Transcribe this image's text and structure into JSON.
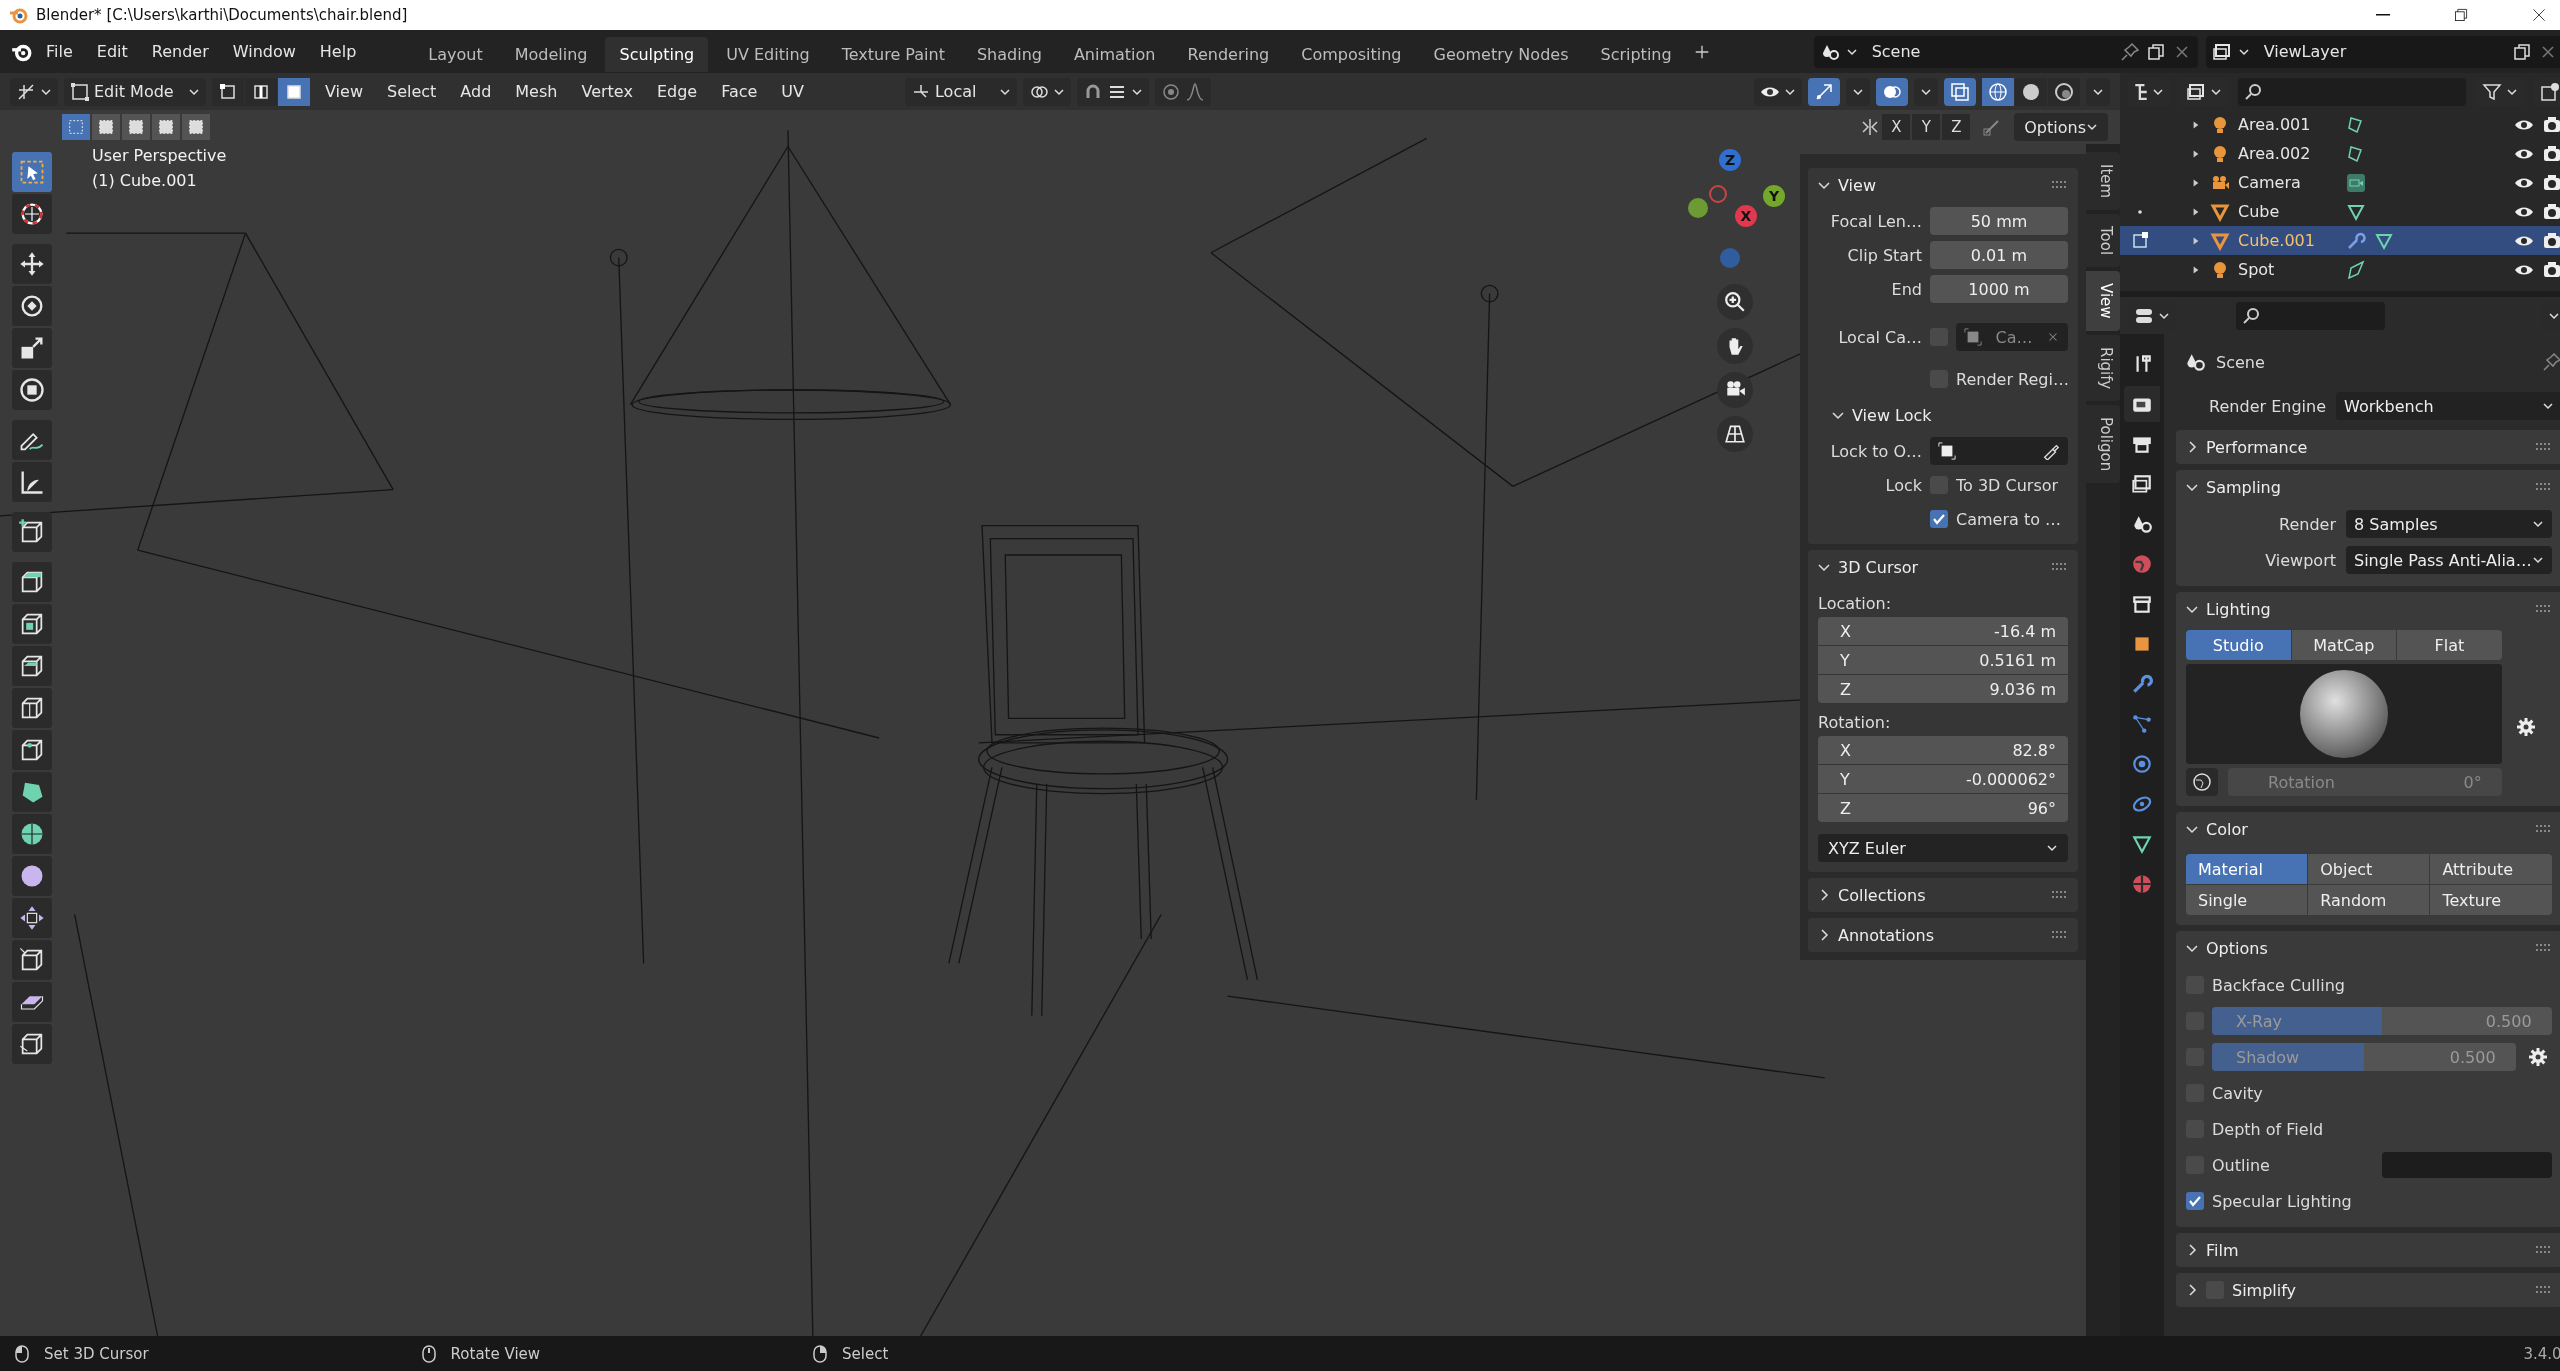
{
  "window": {
    "title": "Blender* [C:\\Users\\karthi\\Documents\\chair.blend]"
  },
  "menu": [
    "File",
    "Edit",
    "Render",
    "Window",
    "Help"
  ],
  "workspaces": [
    {
      "label": "Layout",
      "selected": false
    },
    {
      "label": "Modeling",
      "selected": false
    },
    {
      "label": "Sculpting",
      "selected": true
    },
    {
      "label": "UV Editing",
      "selected": false
    },
    {
      "label": "Texture Paint",
      "selected": false
    },
    {
      "label": "Shading",
      "selected": false
    },
    {
      "label": "Animation",
      "selected": false
    },
    {
      "label": "Rendering",
      "selected": false
    },
    {
      "label": "Compositing",
      "selected": false
    },
    {
      "label": "Geometry Nodes",
      "selected": false
    },
    {
      "label": "Scripting",
      "selected": false
    }
  ],
  "scene": {
    "name": "Scene"
  },
  "view_layer": {
    "name": "ViewLayer"
  },
  "viewport": {
    "header": {
      "mode": "Edit Mode",
      "select_modes": [
        {
          "kind": "vertex",
          "selected": false
        },
        {
          "kind": "edge",
          "selected": false
        },
        {
          "kind": "face",
          "selected": true
        }
      ],
      "menus": [
        "View",
        "Select",
        "Add",
        "Mesh",
        "Vertex",
        "Edge",
        "Face",
        "UV"
      ],
      "orientation": "Local",
      "toggles": [
        {
          "kind": "gizmo",
          "on": true
        },
        {
          "kind": "overlay",
          "on": true
        },
        {
          "kind": "xray",
          "on": true
        }
      ],
      "shading": [
        {
          "kind": "wireframe",
          "selected": true
        },
        {
          "kind": "solid",
          "selected": false
        },
        {
          "kind": "material",
          "selected": false
        }
      ],
      "axes": [
        "X",
        "Y",
        "Z"
      ],
      "options": "Options"
    },
    "overlay_text": [
      "User Perspective",
      "(1) Cube.001"
    ],
    "tool_groups": [
      [
        {
          "kind": "select",
          "selected": true
        },
        {
          "kind": "cursor",
          "selected": false
        }
      ],
      [
        {
          "kind": "move",
          "selected": false
        },
        {
          "kind": "rotate",
          "selected": false
        },
        {
          "kind": "scale",
          "selected": false
        },
        {
          "kind": "transform",
          "selected": false
        }
      ],
      [
        {
          "kind": "annotate",
          "selected": false
        },
        {
          "kind": "measure",
          "selected": false
        }
      ],
      [
        {
          "kind": "add_cube",
          "selected": false
        }
      ],
      [
        {
          "kind": "extrude",
          "selected": false
        },
        {
          "kind": "inset",
          "selected": false
        },
        {
          "kind": "bevel",
          "selected": false
        },
        {
          "kind": "loop_cut",
          "selected": false
        },
        {
          "kind": "knife",
          "selected": false
        },
        {
          "kind": "poly_build",
          "selected": false
        },
        {
          "kind": "spin",
          "selected": false
        },
        {
          "kind": "smooth",
          "selected": false
        },
        {
          "kind": "slide",
          "selected": false
        },
        {
          "kind": "shrink",
          "selected": false
        },
        {
          "kind": "shear",
          "selected": false
        },
        {
          "kind": "rip",
          "selected": false
        }
      ]
    ],
    "gizmo": [
      {
        "kind": "z",
        "label": "Z"
      },
      {
        "kind": "y",
        "label": "Y"
      },
      {
        "kind": "x",
        "label": "X"
      }
    ],
    "sidebar": {
      "tabs": [
        {
          "label": "Item",
          "selected": false
        },
        {
          "label": "Tool",
          "selected": false
        },
        {
          "label": "View",
          "selected": true
        },
        {
          "label": "Rigify",
          "selected": false
        },
        {
          "label": "Poligon",
          "selected": false
        }
      ],
      "view": {
        "title": "View",
        "expanded": true,
        "fields": [
          {
            "label": "Focal Len…",
            "value": "50 mm"
          },
          {
            "label": "Clip Start",
            "value": "0.01 m"
          },
          {
            "label": "End",
            "value": "1000 m"
          }
        ],
        "local_camera": {
          "label": "Local Ca…",
          "checked": false,
          "value": "Ca…"
        },
        "render_region": {
          "label": "Render Regi…",
          "checked": false
        },
        "view_lock": {
          "title": "View Lock",
          "expanded": true,
          "lock_to": "Lock to O…",
          "lock_label": "Lock",
          "options": [
            {
              "label": "To 3D Cursor",
              "checked": false
            },
            {
              "label": "Camera to …",
              "checked": true
            }
          ]
        }
      },
      "cursor": {
        "title": "3D Cursor",
        "expanded": true,
        "location_label": "Location:",
        "location": [
          {
            "axis": "X",
            "value": "-16.4 m"
          },
          {
            "axis": "Y",
            "value": "0.5161 m"
          },
          {
            "axis": "Z",
            "value": "9.036 m"
          }
        ],
        "rotation_label": "Rotation:",
        "rotation": [
          {
            "axis": "X",
            "value": "82.8°"
          },
          {
            "axis": "Y",
            "value": "-0.000062°"
          },
          {
            "axis": "Z",
            "value": "96°"
          }
        ],
        "mode": "XYZ Euler"
      },
      "panels": [
        {
          "title": "Collections",
          "expanded": false
        },
        {
          "title": "Annotations",
          "expanded": false
        }
      ]
    }
  },
  "outliner": {
    "rows": [
      {
        "name": "Area.001",
        "kind": "area_light",
        "selected": false,
        "editing": false,
        "edit_dot": false
      },
      {
        "name": "Area.002",
        "kind": "area_light",
        "selected": false,
        "editing": false,
        "edit_dot": false
      },
      {
        "name": "Camera",
        "kind": "camera",
        "selected": false,
        "editing": false,
        "edit_dot": false
      },
      {
        "name": "Cube",
        "kind": "mesh",
        "selected": false,
        "editing": false,
        "edit_dot": true
      },
      {
        "name": "Cube.001",
        "kind": "mesh",
        "selected": true,
        "editing": true,
        "edit_dot": false,
        "modifier": true
      },
      {
        "name": "Spot",
        "kind": "spot_light",
        "selected": false,
        "editing": false,
        "edit_dot": false
      }
    ]
  },
  "properties": {
    "tabs": [
      {
        "kind": "tool",
        "selected": false
      },
      {
        "kind": "render",
        "selected": true
      },
      {
        "kind": "output",
        "selected": false
      },
      {
        "kind": "view_layer",
        "selected": false
      },
      {
        "kind": "scene",
        "selected": false
      },
      {
        "kind": "world",
        "selected": false
      },
      {
        "kind": "collection",
        "selected": false
      },
      {
        "kind": "object",
        "selected": false
      },
      {
        "kind": "modifiers",
        "selected": false
      },
      {
        "kind": "particles",
        "selected": false
      },
      {
        "kind": "physics",
        "selected": false
      },
      {
        "kind": "constraints",
        "selected": false
      },
      {
        "kind": "data",
        "selected": false
      },
      {
        "kind": "material",
        "selected": false
      }
    ],
    "context": "Scene",
    "render_engine": {
      "label": "Render Engine",
      "value": "Workbench"
    },
    "panels": [
      {
        "kind": "plain",
        "title": "Performance",
        "expanded": false
      },
      {
        "kind": "sampling",
        "title": "Sampling",
        "expanded": true,
        "rows": [
          {
            "label": "Render",
            "value": "8 Samples"
          },
          {
            "label": "Viewport",
            "value": "Single Pass Anti-Alia…"
          }
        ]
      },
      {
        "kind": "lighting",
        "title": "Lighting",
        "expanded": true,
        "modes": [
          {
            "label": "Studio",
            "selected": true
          },
          {
            "label": "MatCap",
            "selected": false
          },
          {
            "label": "Flat",
            "selected": false
          }
        ],
        "rotation": {
          "label": "Rotation",
          "value": "0°",
          "disabled": true
        }
      },
      {
        "kind": "color",
        "title": "Color",
        "expanded": true,
        "options": [
          {
            "label": "Material",
            "selected": true
          },
          {
            "label": "Object",
            "selected": false
          },
          {
            "label": "Attribute",
            "selected": false
          },
          {
            "label": "Single",
            "selected": false
          },
          {
            "label": "Random",
            "selected": false
          },
          {
            "label": "Texture",
            "selected": false
          }
        ]
      },
      {
        "kind": "options",
        "title": "Options",
        "expanded": true,
        "items": [
          {
            "kind": "check",
            "label": "Backface Culling",
            "checked": false
          },
          {
            "kind": "slider",
            "label": "X-Ray",
            "checked": false,
            "level": 0.5,
            "value": "0.500",
            "settings": false
          },
          {
            "kind": "slider",
            "label": "Shadow",
            "checked": false,
            "level": 0.5,
            "value": "0.500",
            "settings": true
          },
          {
            "kind": "check",
            "label": "Cavity",
            "checked": false
          },
          {
            "kind": "check",
            "label": "Depth of Field",
            "checked": false
          },
          {
            "kind": "swatch",
            "label": "Outline",
            "checked": false
          },
          {
            "kind": "check",
            "label": "Specular Lighting",
            "checked": true
          }
        ]
      },
      {
        "kind": "plain",
        "title": "Film",
        "expanded": false
      },
      {
        "kind": "plain",
        "title": "Simplify",
        "expanded": false,
        "checked": false
      }
    ]
  },
  "status_bar": {
    "hints": [
      {
        "kind": "left",
        "text": "Set 3D Cursor"
      },
      {
        "kind": "middle",
        "text": "Rotate View"
      },
      {
        "kind": "right",
        "text": "Select"
      }
    ],
    "version": "3.4.0"
  }
}
